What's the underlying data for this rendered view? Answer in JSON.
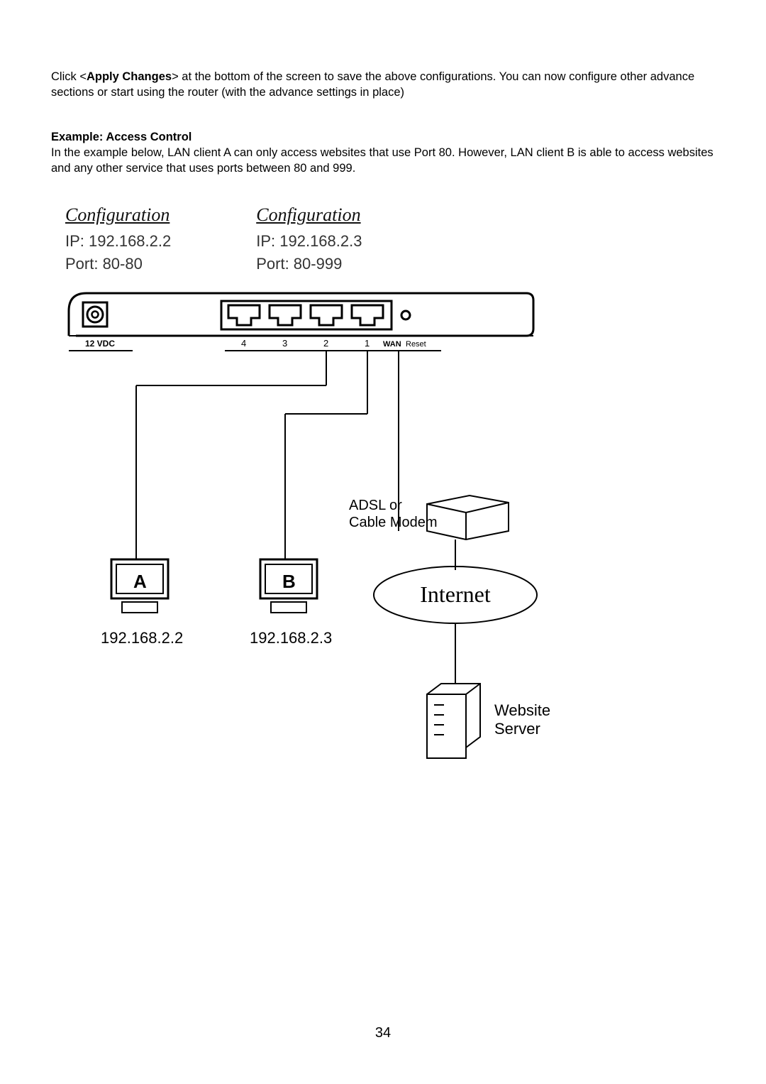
{
  "intro": {
    "prefix": "Click <",
    "button_label": "Apply Changes",
    "suffix": "> at the bottom of the screen to save the above configurations. You can now configure other advance sections or start using the router (with the advance settings in place)"
  },
  "example": {
    "heading": "Example: Access Control",
    "body": "In the example below, LAN client A can only access websites that use Port 80. However, LAN client B is able to access websites and any other service that uses ports between 80 and 999."
  },
  "configA": {
    "title": "Configuration",
    "ip": "IP: 192.168.2.2",
    "port": "Port: 80-80"
  },
  "configB": {
    "title": "Configuration",
    "ip": "IP: 192.168.2.3",
    "port": "Port: 80-999"
  },
  "diagram": {
    "router": {
      "power_label": "12 VDC",
      "port4": "4",
      "port3": "3",
      "port2": "2",
      "port1": "1",
      "wan": "WAN",
      "reset": "Reset"
    },
    "modem_label": "ADSL or\nCable Modem",
    "clientA": {
      "letter": "A",
      "ip": "192.168.2.2"
    },
    "clientB": {
      "letter": "B",
      "ip": "192.168.2.3"
    },
    "internet": "Internet",
    "server": "Website\nServer"
  },
  "page_number": "34"
}
